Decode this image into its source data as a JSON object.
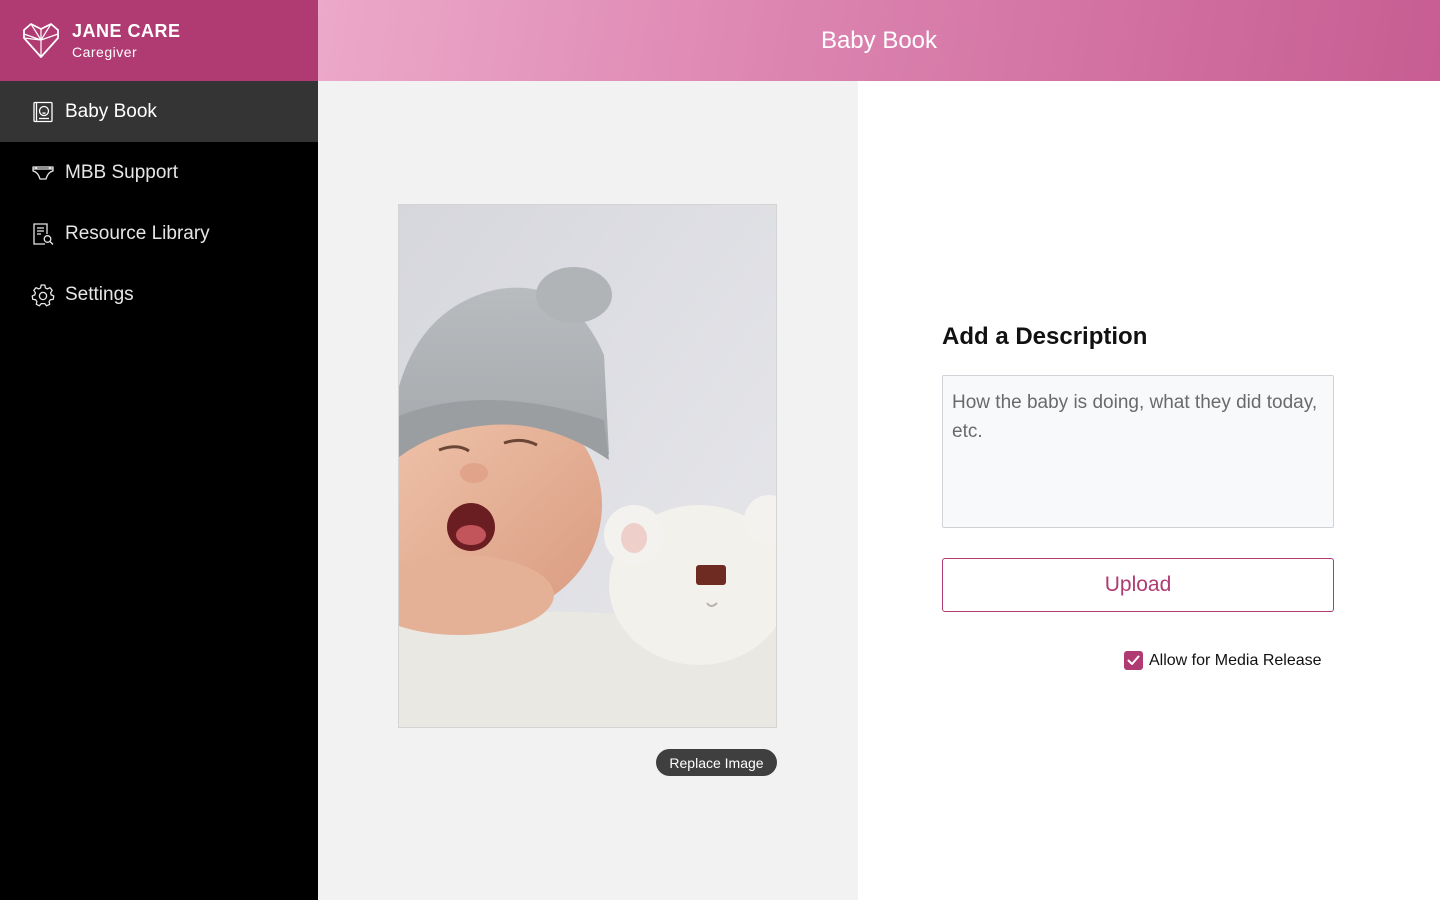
{
  "brand": {
    "name": "JANE CARE",
    "role": "Caregiver",
    "logo_icon": "heart-gem-icon",
    "color": "#b03a72"
  },
  "header": {
    "title": "Baby Book"
  },
  "sidebar": {
    "items": [
      {
        "label": "Baby Book",
        "icon": "baby-book-icon",
        "active": true
      },
      {
        "label": "MBB Support",
        "icon": "diaper-icon",
        "active": false
      },
      {
        "label": "Resource Library",
        "icon": "document-search-icon",
        "active": false
      },
      {
        "label": "Settings",
        "icon": "gear-icon",
        "active": false
      }
    ]
  },
  "photo": {
    "replace_label": "Replace Image"
  },
  "form": {
    "heading": "Add a Description",
    "placeholder": "How the baby is doing, what they did today, etc.",
    "value": "",
    "upload_label": "Upload",
    "media_release_label": "Allow for Media Release",
    "media_release_checked": true
  },
  "colors": {
    "accent": "#b03a72",
    "sidebar_bg": "#000000",
    "active_item_bg": "#333433"
  }
}
